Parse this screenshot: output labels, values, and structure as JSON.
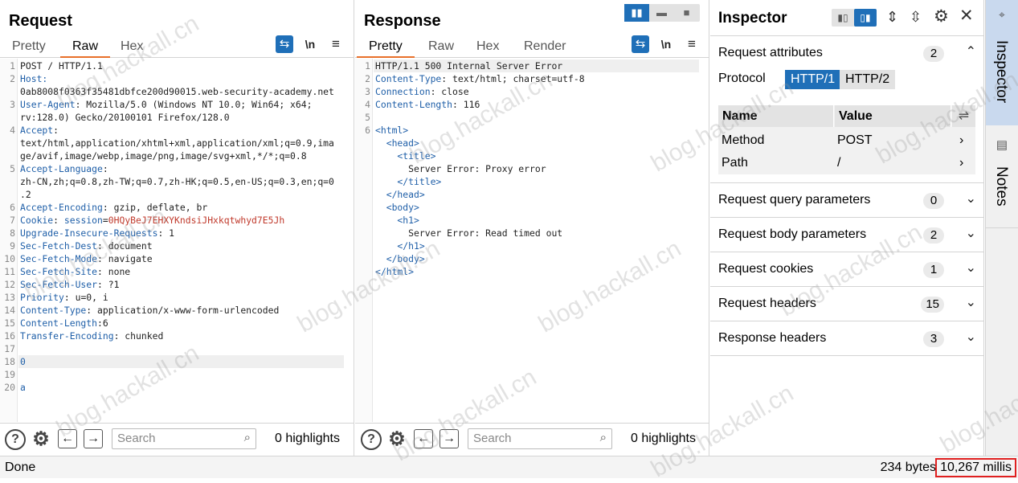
{
  "request": {
    "title": "Request",
    "tabs": [
      "Pretty",
      "Raw",
      "Hex"
    ],
    "active_tab": "Raw",
    "lines": [
      {
        "n": "1",
        "segs": [
          [
            "POST / HTTP/1.1",
            ""
          ]
        ]
      },
      {
        "n": "2",
        "segs": [
          [
            "Host:",
            "k"
          ]
        ]
      },
      {
        "n": "",
        "segs": [
          [
            "0ab8008f0363f35481dbfce200d90015.web-security-academy.net",
            ""
          ]
        ]
      },
      {
        "n": "3",
        "segs": [
          [
            "User-Agent",
            "k"
          ],
          [
            ": Mozilla/5.0 (Windows NT 10.0; Win64; x64;",
            ""
          ]
        ]
      },
      {
        "n": "",
        "segs": [
          [
            "rv:128.0) Gecko/20100101 Firefox/128.0",
            ""
          ]
        ]
      },
      {
        "n": "4",
        "segs": [
          [
            "Accept",
            "k"
          ],
          [
            ":",
            ""
          ]
        ]
      },
      {
        "n": "",
        "segs": [
          [
            "text/html,application/xhtml+xml,application/xml;q=0.9,ima",
            ""
          ]
        ]
      },
      {
        "n": "",
        "segs": [
          [
            "ge/avif,image/webp,image/png,image/svg+xml,*/*;q=0.8",
            ""
          ]
        ]
      },
      {
        "n": "5",
        "segs": [
          [
            "Accept-Language",
            "k"
          ],
          [
            ":",
            ""
          ]
        ]
      },
      {
        "n": "",
        "segs": [
          [
            "zh-CN,zh;q=0.8,zh-TW;q=0.7,zh-HK;q=0.5,en-US;q=0.3,en;q=0",
            ""
          ]
        ]
      },
      {
        "n": "",
        "segs": [
          [
            ".2",
            ""
          ]
        ]
      },
      {
        "n": "6",
        "segs": [
          [
            "Accept-Encoding",
            "k"
          ],
          [
            ": gzip, deflate, br",
            ""
          ]
        ]
      },
      {
        "n": "7",
        "segs": [
          [
            "Cookie",
            "k"
          ],
          [
            ": ",
            ""
          ],
          [
            "session",
            "k"
          ],
          [
            "=",
            ""
          ],
          [
            "0HQyBeJ7EHXYKndsiJHxkqtwhyd7E5Jh",
            "r"
          ]
        ]
      },
      {
        "n": "8",
        "segs": [
          [
            "Upgrade-Insecure-Requests",
            "k"
          ],
          [
            ": 1",
            ""
          ]
        ]
      },
      {
        "n": "9",
        "segs": [
          [
            "Sec-Fetch-Dest",
            "k"
          ],
          [
            ": document",
            ""
          ]
        ]
      },
      {
        "n": "10",
        "segs": [
          [
            "Sec-Fetch-Mode",
            "k"
          ],
          [
            ": navigate",
            ""
          ]
        ]
      },
      {
        "n": "11",
        "segs": [
          [
            "Sec-Fetch-Site",
            "k"
          ],
          [
            ": none",
            ""
          ]
        ]
      },
      {
        "n": "12",
        "segs": [
          [
            "Sec-Fetch-User",
            "k"
          ],
          [
            ": ?1",
            ""
          ]
        ]
      },
      {
        "n": "13",
        "segs": [
          [
            "Priority",
            "k"
          ],
          [
            ": u=0, i",
            ""
          ]
        ]
      },
      {
        "n": "14",
        "segs": [
          [
            "Content-Type",
            "k"
          ],
          [
            ": application/x-www-form-urlencoded",
            ""
          ]
        ]
      },
      {
        "n": "15",
        "segs": [
          [
            "Content-Length",
            "k"
          ],
          [
            ":6",
            ""
          ]
        ]
      },
      {
        "n": "16",
        "segs": [
          [
            "Transfer-Encoding",
            "k"
          ],
          [
            ": chunked",
            ""
          ]
        ]
      },
      {
        "n": "17",
        "segs": [
          [
            "",
            ""
          ]
        ]
      },
      {
        "n": "18",
        "segs": [
          [
            "0",
            "k"
          ]
        ],
        "hl": true
      },
      {
        "n": "19",
        "segs": [
          [
            "",
            ""
          ]
        ]
      },
      {
        "n": "20",
        "segs": [
          [
            "a",
            "k"
          ]
        ]
      }
    ],
    "search_placeholder": "Search",
    "highlights": "0 highlights"
  },
  "response": {
    "title": "Response",
    "tabs": [
      "Pretty",
      "Raw",
      "Hex",
      "Render"
    ],
    "active_tab": "Pretty",
    "lines": [
      {
        "n": "1",
        "segs": [
          [
            "HTTP/1.1 500 Internal Server Error",
            ""
          ]
        ],
        "hl": true
      },
      {
        "n": "2",
        "segs": [
          [
            "Content-Type",
            "k"
          ],
          [
            ": text/html; charset=utf-8",
            ""
          ]
        ]
      },
      {
        "n": "3",
        "segs": [
          [
            "Connection",
            "k"
          ],
          [
            ": close",
            ""
          ]
        ]
      },
      {
        "n": "4",
        "segs": [
          [
            "Content-Length",
            "k"
          ],
          [
            ": 116",
            ""
          ]
        ]
      },
      {
        "n": "5",
        "segs": [
          [
            "",
            ""
          ]
        ]
      },
      {
        "n": "6",
        "segs": [
          [
            "<html>",
            "tg"
          ]
        ]
      },
      {
        "n": "",
        "segs": [
          [
            "  <head>",
            "tg"
          ]
        ]
      },
      {
        "n": "",
        "segs": [
          [
            "    <title>",
            "tg"
          ]
        ]
      },
      {
        "n": "",
        "segs": [
          [
            "      Server Error: Proxy error",
            ""
          ]
        ]
      },
      {
        "n": "",
        "segs": [
          [
            "    </title>",
            "tg"
          ]
        ]
      },
      {
        "n": "",
        "segs": [
          [
            "  </head>",
            "tg"
          ]
        ]
      },
      {
        "n": "",
        "segs": [
          [
            "  <body>",
            "tg"
          ]
        ]
      },
      {
        "n": "",
        "segs": [
          [
            "    <h1>",
            "tg"
          ]
        ]
      },
      {
        "n": "",
        "segs": [
          [
            "      Server Error: Read timed out",
            ""
          ]
        ]
      },
      {
        "n": "",
        "segs": [
          [
            "    </h1>",
            "tg"
          ]
        ]
      },
      {
        "n": "",
        "segs": [
          [
            "  </body>",
            "tg"
          ]
        ]
      },
      {
        "n": "",
        "segs": [
          [
            "</html>",
            "tg"
          ]
        ]
      }
    ],
    "search_placeholder": "Search",
    "highlights": "0 highlights"
  },
  "inspector": {
    "title": "Inspector",
    "request_attributes": {
      "label": "Request attributes",
      "count": "2"
    },
    "protocol_label": "Protocol",
    "protocol_options": [
      "HTTP/1",
      "HTTP/2"
    ],
    "protocol_selected": "HTTP/1",
    "table": {
      "headers": [
        "Name",
        "Value"
      ],
      "rows": [
        [
          "Method",
          "POST"
        ],
        [
          "Path",
          "/"
        ]
      ]
    },
    "sections": [
      {
        "label": "Request query parameters",
        "count": "0"
      },
      {
        "label": "Request body parameters",
        "count": "2"
      },
      {
        "label": "Request cookies",
        "count": "1"
      },
      {
        "label": "Request headers",
        "count": "15"
      },
      {
        "label": "Response headers",
        "count": "3"
      }
    ]
  },
  "side_tabs": [
    "Inspector",
    "Notes"
  ],
  "status": {
    "left": "Done",
    "bytes": "234 bytes",
    "millis": "10,267 millis"
  },
  "watermark": "blog.hackall.cn",
  "colors": {
    "accent_blue": "#1f6fb8",
    "tab_orange": "#e8702a",
    "header_key": "#1f5fa8",
    "cookie_value": "#c0392b",
    "status_box": "#e02020"
  }
}
